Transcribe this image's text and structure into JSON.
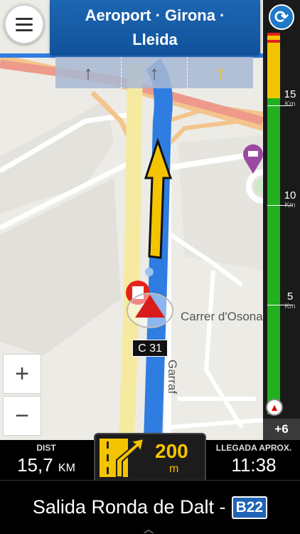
{
  "header": {
    "destination": "Aeroport · Girona · Lleida"
  },
  "icons": {
    "menu": "hamburger-menu-icon",
    "refresh": "refresh-route-icon",
    "lane_arrow": "straight-arrow-icon",
    "hotel_poi": "hotel-pin-icon",
    "vehicle": "vehicle-position-icon",
    "maneuver": "exit-right-icon"
  },
  "map": {
    "road_label": "C 31",
    "street_1": "Carrer d'Osona",
    "street_2": "Garraf",
    "zoom_in": "+",
    "zoom_out": "−",
    "lanes": [
      "↑",
      "↑",
      "↑"
    ]
  },
  "sidebar": {
    "km_15": "15",
    "km_10": "10",
    "km_5": "5",
    "km_unit": "Km",
    "delay": "+6"
  },
  "bottom": {
    "dist_label": "DIST",
    "dist_value": "15,7",
    "dist_unit": "KM",
    "maneuver_distance": "200",
    "maneuver_unit": "m",
    "eta_label": "LLEGADA APROX.",
    "eta_value": "11:38",
    "next_street": "Salida Ronda de Dalt -",
    "road_badge": "B22"
  },
  "colors": {
    "route": "#2f7de0",
    "turn_arrow": "#f5c400",
    "banner": "#1860ad",
    "traffic_green": "#22b01f",
    "traffic_yellow": "#f5c400",
    "traffic_red": "#e02020"
  }
}
